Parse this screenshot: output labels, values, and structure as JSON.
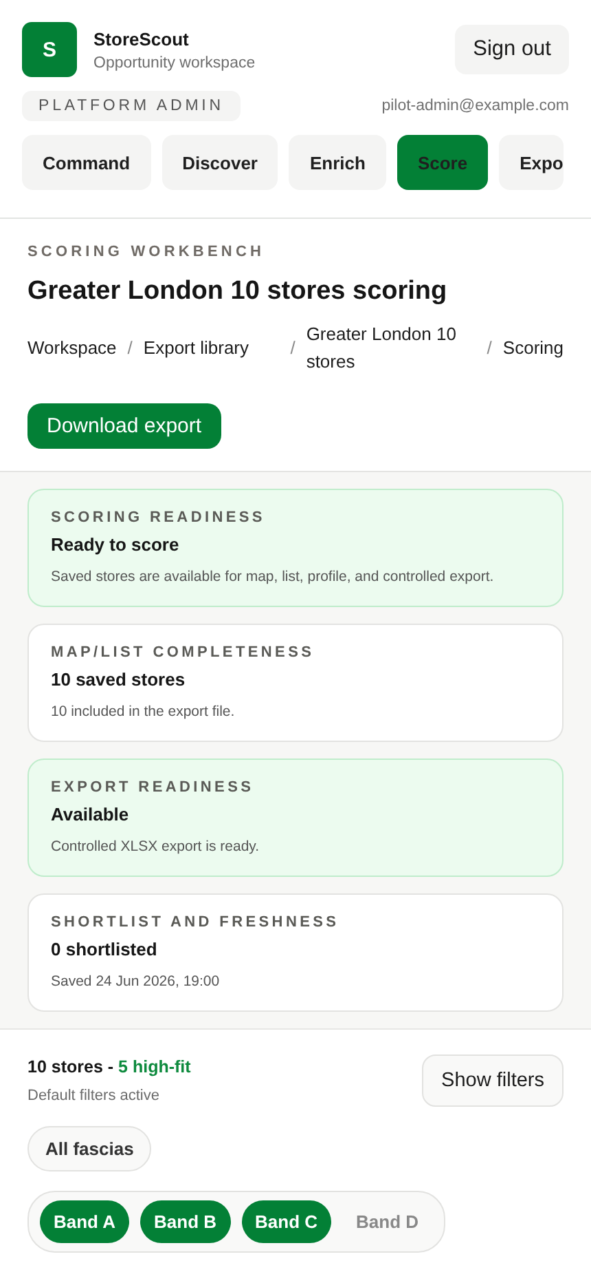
{
  "brand": {
    "logo_letter": "S",
    "name": "StoreScout",
    "subtitle": "Opportunity workspace"
  },
  "sign_out": "Sign out",
  "role_badge": "PLATFORM ADMIN",
  "email": "pilot-admin@example.com",
  "nav_tabs": [
    {
      "label": "Command",
      "selected": false
    },
    {
      "label": "Discover",
      "selected": false
    },
    {
      "label": "Enrich",
      "selected": false
    },
    {
      "label": "Score",
      "selected": true
    },
    {
      "label": "Expo",
      "selected": false
    }
  ],
  "page": {
    "eyebrow": "SCORING WORKBENCH",
    "title": "Greater London 10 stores scoring",
    "breadcrumbs": [
      "Workspace",
      "Export library",
      "Greater London 10 stores",
      "Scoring"
    ],
    "separator": "/",
    "action": "Download export"
  },
  "status_cards": [
    {
      "kind": "ready",
      "label": "SCORING READINESS",
      "value": "Ready to score",
      "note": "Saved stores are available for map, list, profile, and controlled export."
    },
    {
      "kind": "neutral",
      "label": "MAP/LIST COMPLETENESS",
      "value": "10 saved stores",
      "note": "10 included in the export file."
    },
    {
      "kind": "ready",
      "label": "EXPORT READINESS",
      "value": "Available",
      "note": "Controlled XLSX export is ready."
    },
    {
      "kind": "neutral",
      "label": "SHORTLIST AND FRESHNESS",
      "value": "0 shortlisted",
      "note": "Saved 24 Jun 2026, 19:00"
    }
  ],
  "results": {
    "count": "10 stores",
    "separator": "-",
    "highlight": "5 high-fit",
    "note": "Default filters active",
    "filters_button": "Show filters"
  },
  "fascia_chip": "All fascias",
  "bands": [
    {
      "label": "Band A",
      "selected": true
    },
    {
      "label": "Band B",
      "selected": true
    },
    {
      "label": "Band C",
      "selected": true
    },
    {
      "label": "Band D",
      "selected": false
    }
  ]
}
